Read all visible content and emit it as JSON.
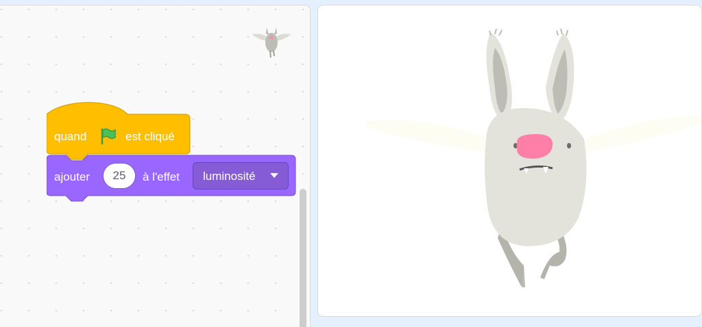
{
  "workspace": {
    "event_block": {
      "label_before": "quand",
      "flag_icon": "green-flag-icon",
      "label_after": "est cliqué",
      "color": "#ffbf00"
    },
    "effect_block": {
      "label_before": "ajouter",
      "value": "25",
      "label_middle": "à l'effet",
      "effect": "luminosité",
      "color": "#9966ff"
    }
  },
  "stage": {
    "sprite": "bat-sprite"
  }
}
